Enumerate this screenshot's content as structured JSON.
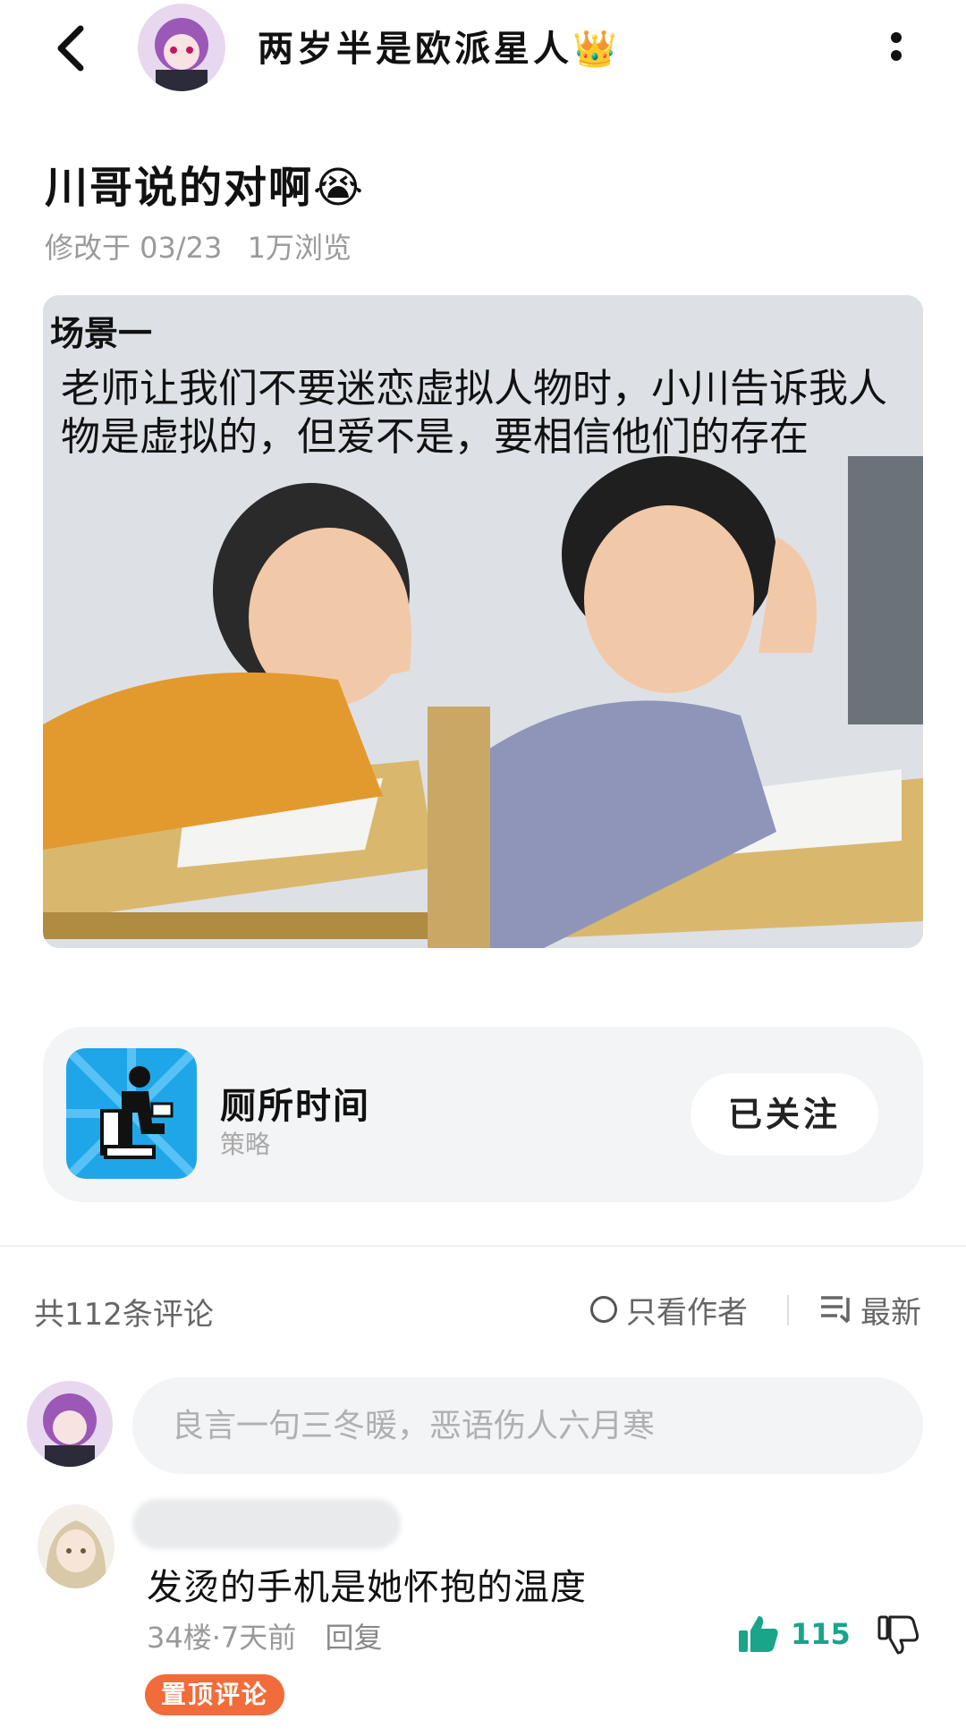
{
  "header": {
    "author_name": "两岁半是欧派星人👑",
    "back_icon": "chevron-left-icon",
    "more_icon": "more-vertical-icon"
  },
  "post": {
    "title": "川哥说的对啊😭",
    "modified": "修改于 03/23",
    "views": "1万浏览",
    "image": {
      "scene_label": "场景一",
      "caption": "老师让我们不要迷恋虚拟人物时，小川告诉我人物是虚拟的，但爱不是，要相信他们的存在"
    }
  },
  "app_card": {
    "name": "厕所时间",
    "category": "策略",
    "follow_label": "已关注",
    "icon_bg": "#1fa6e8"
  },
  "comments": {
    "count_label": "共112条评论",
    "only_author_label": "只看作者",
    "sort_label": "最新",
    "input_placeholder": "良言一句三冬暖，恶语伤人六月寒",
    "items": [
      {
        "text": "发烫的手机是她怀抱的温度",
        "floor": "34楼",
        "time": "7天前",
        "reply_label": "回复",
        "likes": "115",
        "pinned_label": "置顶评论"
      }
    ]
  },
  "colors": {
    "accent_like": "#1aa48a",
    "pin_badge": "#f26b3a"
  }
}
